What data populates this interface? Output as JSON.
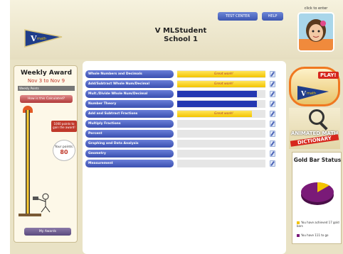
{
  "header": {
    "student_name": "V MLStudent",
    "school": "School 1",
    "test_center": "TEST CENTER",
    "help": "HELP",
    "avatar_label": "click to enter"
  },
  "sidebar": {
    "weekly_award_title": "Weekly Award",
    "dates": "Nov 3 to Nov 9",
    "weekly_points": "Weekly Points",
    "calculator_button": "How is this Calculated?",
    "goal_badge": "1000 points to gain the award!",
    "points_label": "Your points:",
    "points_value": "80",
    "my_awards_button": "My Awards"
  },
  "topics": [
    {
      "label": "Whole Numbers and Decimals",
      "progress": 1.0,
      "color": "gold",
      "status": "Great work!"
    },
    {
      "label": "Add/Subtract Whole Num/Decimal",
      "progress": 1.0,
      "color": "gold",
      "status": "Great work!"
    },
    {
      "label": "Mult./Divide Whole Num/Decimal",
      "progress": 0.9,
      "color": "blue",
      "status": ""
    },
    {
      "label": "Number Theory",
      "progress": 0.9,
      "color": "blue",
      "status": ""
    },
    {
      "label": "Add and Subtract Fractions",
      "progress": 0.85,
      "color": "gold",
      "status": "Great work!"
    },
    {
      "label": "Multiply Fractions",
      "progress": 0,
      "color": "none",
      "status": ""
    },
    {
      "label": "Percent",
      "progress": 0,
      "color": "none",
      "status": ""
    },
    {
      "label": "Graphing and Data Analysis",
      "progress": 0,
      "color": "none",
      "status": ""
    },
    {
      "label": "Geometry",
      "progress": 0,
      "color": "none",
      "status": ""
    },
    {
      "label": "Measurement",
      "progress": 0,
      "color": "none",
      "status": ""
    }
  ],
  "right": {
    "play_label": "PLAY!",
    "dictionary_line1": "ANIMATED MATH",
    "dictionary_line2": "DICTIONARY",
    "gold_bar_title": "Gold Bar Status",
    "legend_achieved": "You have achieved 17 gold bars",
    "legend_to_go": "You have 111 to go",
    "achieved_fraction": 0.13
  },
  "colors": {
    "gold": "#f3c400",
    "blue": "#2438b2",
    "topic_button": "#3a4fb0",
    "orange_ring": "#f07820",
    "pie_main": "#7a1a78",
    "pie_gold": "#f3c400"
  }
}
